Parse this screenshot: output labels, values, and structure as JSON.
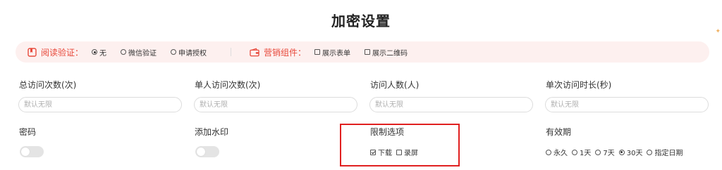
{
  "page": {
    "title": "加密设置"
  },
  "colors": {
    "accent": "#e84a3c",
    "highlight_border": "#e02020",
    "bar_bg": "#fdf0ef"
  },
  "read_verify": {
    "icon": "bookmark-icon",
    "label": "阅读验证：",
    "options": [
      {
        "label": "无",
        "selected": true
      },
      {
        "label": "微信验证",
        "selected": false
      },
      {
        "label": "申请授权",
        "selected": false
      }
    ]
  },
  "marketing": {
    "icon": "wallet-icon",
    "label": "营销组件：",
    "options": [
      {
        "label": "展示表单",
        "checked": false
      },
      {
        "label": "展示二维码",
        "checked": false
      }
    ]
  },
  "fields": [
    {
      "label": "总访问次数(次)",
      "placeholder": "默认无限"
    },
    {
      "label": "单人访问次数(次)",
      "placeholder": "默认无限"
    },
    {
      "label": "访问人数(人)",
      "placeholder": "默认无限"
    },
    {
      "label": "单次访问时长(秒)",
      "placeholder": "默认无限"
    }
  ],
  "password": {
    "label": "密码",
    "enabled": false
  },
  "watermark": {
    "label": "添加水印",
    "enabled": false
  },
  "limits": {
    "label": "限制选项",
    "options": [
      {
        "label": "下载",
        "checked": true
      },
      {
        "label": "录屏",
        "checked": false
      }
    ]
  },
  "validity": {
    "label": "有效期",
    "options": [
      {
        "label": "永久",
        "selected": false
      },
      {
        "label": "1天",
        "selected": false
      },
      {
        "label": "7天",
        "selected": false
      },
      {
        "label": "30天",
        "selected": true
      },
      {
        "label": "指定日期",
        "selected": false
      }
    ]
  }
}
